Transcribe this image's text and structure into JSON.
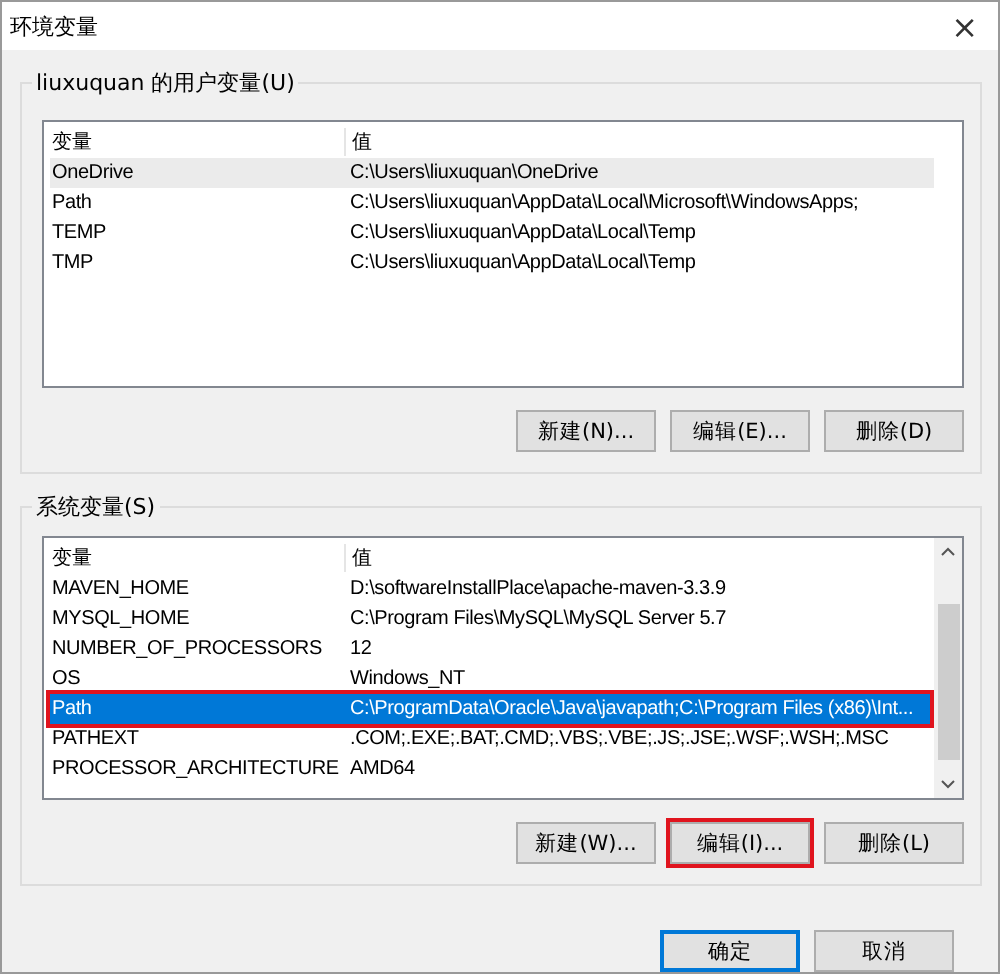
{
  "window": {
    "title": "环境变量",
    "close": "×"
  },
  "user_variables": {
    "label": "liuxuquan 的用户变量(U)",
    "columns": [
      "变量",
      "值"
    ],
    "rows": [
      {
        "name": "OneDrive",
        "value": "C:\\Users\\liuxuquan\\OneDrive",
        "selected": false,
        "hovered": true
      },
      {
        "name": "Path",
        "value": "C:\\Users\\liuxuquan\\AppData\\Local\\Microsoft\\WindowsApps;",
        "selected": false,
        "hovered": false
      },
      {
        "name": "TEMP",
        "value": "C:\\Users\\liuxuquan\\AppData\\Local\\Temp",
        "selected": false,
        "hovered": false
      },
      {
        "name": "TMP",
        "value": "C:\\Users\\liuxuquan\\AppData\\Local\\Temp",
        "selected": false,
        "hovered": false
      }
    ],
    "buttons": [
      {
        "label": "新建(N)...",
        "annotated": false
      },
      {
        "label": "编辑(E)...",
        "annotated": false
      },
      {
        "label": "删除(D)",
        "annotated": false
      }
    ]
  },
  "system_variables": {
    "label": "系统变量(S)",
    "columns": [
      "变量",
      "值"
    ],
    "rows": [
      {
        "name": "MAVEN_HOME",
        "value": "D:\\softwareInstallPlace\\apache-maven-3.3.9",
        "selected": false,
        "annotated": false
      },
      {
        "name": "MYSQL_HOME",
        "value": "C:\\Program Files\\MySQL\\MySQL Server 5.7",
        "selected": false,
        "annotated": false
      },
      {
        "name": "NUMBER_OF_PROCESSORS",
        "value": "12",
        "selected": false,
        "annotated": false
      },
      {
        "name": "OS",
        "value": "Windows_NT",
        "selected": false,
        "annotated": false
      },
      {
        "name": "Path",
        "value": "C:\\ProgramData\\Oracle\\Java\\javapath;C:\\Program Files (x86)\\Int...",
        "selected": true,
        "annotated": true
      },
      {
        "name": "PATHEXT",
        "value": ".COM;.EXE;.BAT;.CMD;.VBS;.VBE;.JS;.JSE;.WSF;.WSH;.MSC",
        "selected": false,
        "annotated": false
      },
      {
        "name": "PROCESSOR_ARCHITECTURE",
        "value": "AMD64",
        "selected": false,
        "annotated": false
      }
    ],
    "buttons": [
      {
        "label": "新建(W)...",
        "annotated": false
      },
      {
        "label": "编辑(I)...",
        "annotated": true
      },
      {
        "label": "删除(L)",
        "annotated": false
      }
    ]
  },
  "footer_buttons": [
    {
      "label": "确定",
      "default": true
    },
    {
      "label": "取消",
      "default": false
    }
  ]
}
